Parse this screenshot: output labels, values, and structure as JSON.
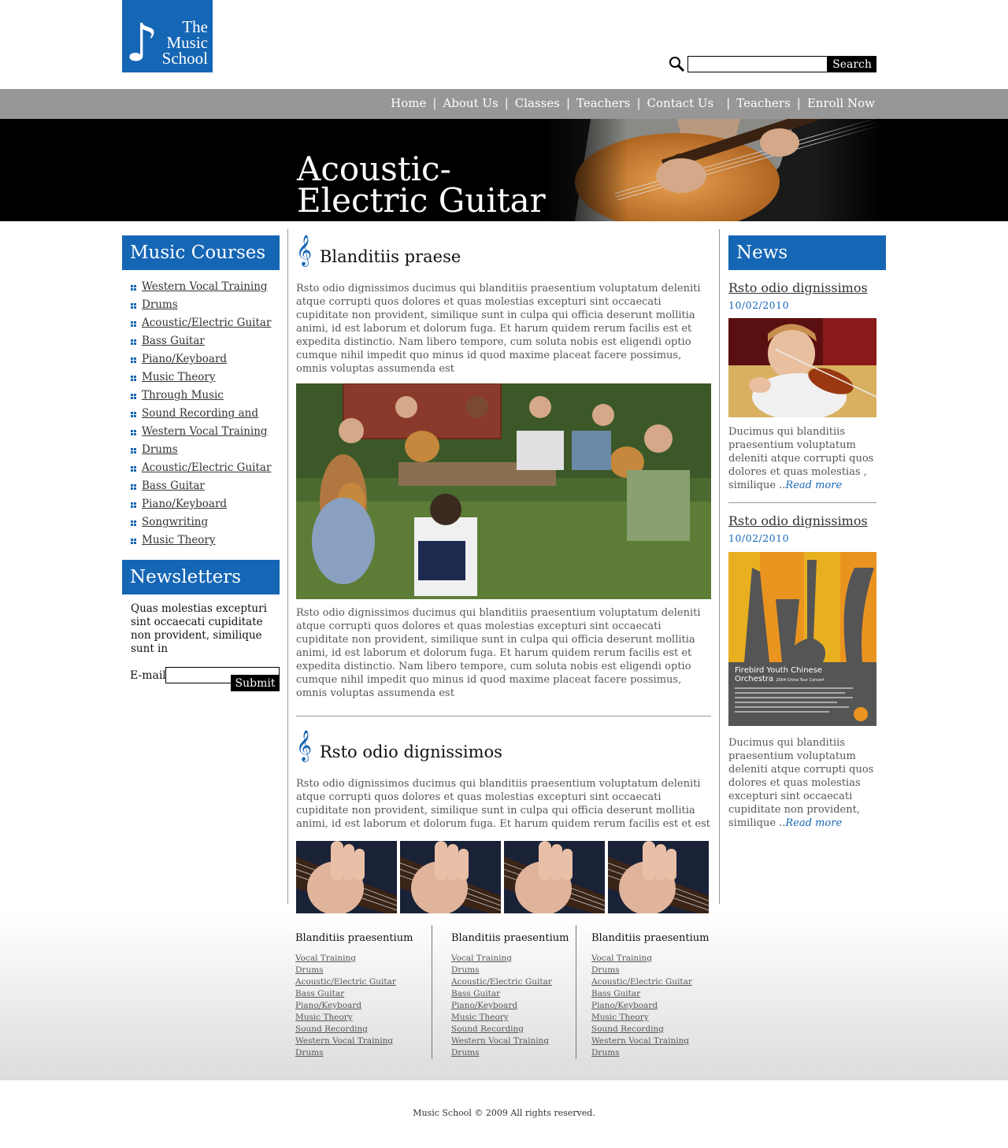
{
  "logo": {
    "line1": "The",
    "line2": "Music",
    "line3": "School"
  },
  "search": {
    "button": "Search",
    "placeholder": ""
  },
  "nav": [
    "Home",
    "About Us",
    "Classes",
    "Teachers",
    "Contact Us",
    "Teachers",
    "Enroll Now"
  ],
  "banner": {
    "line1": "Acoustic-",
    "line2": "Electric Guitar"
  },
  "courses": {
    "title": "Music Courses",
    "items": [
      "Western Vocal Training",
      "Drums",
      "Acoustic/Electric Guitar",
      "Bass Guitar",
      "Piano/Keyboard",
      "Music Theory",
      "Through Music",
      "Sound Recording and ",
      "Western Vocal Training",
      "Drums",
      "Acoustic/Electric Guitar",
      "Bass Guitar",
      "Piano/Keyboard",
      "Songwriting",
      "Music Theory"
    ]
  },
  "newsletters": {
    "title": "Newsletters",
    "text": "Quas molestias excepturi sint occaecati cupiditate non provident, similique sunt in",
    "email_label": "E-mail",
    "email_value": "",
    "submit": "Submit"
  },
  "article1": {
    "title": "Blanditiis praese",
    "para1": "Rsto odio dignissimos ducimus qui blanditiis praesentium voluptatum deleniti atque corrupti quos dolores et quas molestias excepturi sint occaecati cupiditate non provident, similique sunt in culpa qui officia deserunt mollitia animi, id est laborum et dolorum fuga. Et harum quidem rerum facilis est et expedita distinctio. Nam libero tempore, cum soluta nobis est eligendi optio cumque nihil impedit quo minus id quod maxime placeat facere possimus, omnis voluptas assumenda est",
    "para2": "Rsto odio dignissimos ducimus qui blanditiis praesentium voluptatum deleniti atque corrupti quos dolores et quas molestias excepturi sint occaecati cupiditate non provident, similique sunt in culpa qui officia deserunt mollitia animi, id est laborum et dolorum fuga. Et harum quidem rerum facilis est et expedita distinctio. Nam libero tempore, cum soluta nobis est eligendi optio cumque nihil impedit quo minus id quod maxime placeat facere possimus, omnis voluptas assumenda est"
  },
  "article2": {
    "title": "Rsto odio dignissimos",
    "para": "Rsto odio dignissimos ducimus qui blanditiis praesentium voluptatum deleniti atque corrupti quos dolores et quas molestias excepturi sint occaecati cupiditate non provident, similique sunt in culpa qui officia deserunt mollitia animi, id est laborum et dolorum fuga. Et harum quidem rerum facilis est et est"
  },
  "news": {
    "title": "News",
    "items": [
      {
        "title": "Rsto odio dignissimos",
        "date": "10/02/2010",
        "text": "Ducimus qui blanditiis praesentium voluptatum deleniti atque corrupti quos dolores et quas molestias , similique ..",
        "more": "Read more"
      },
      {
        "title": "Rsto odio dignissimos",
        "date": "10/02/2010",
        "text": "Ducimus qui blanditiis praesentium voluptatum deleniti atque corrupti quos dolores et quas molestias excepturi sint occaecati cupiditate non provident, similique ..",
        "more": "Read more"
      }
    ],
    "poster": {
      "line1": "Firebird Youth Chinese",
      "line2": "Orchestra",
      "line3": "2004 China Tour Concert"
    }
  },
  "footer": {
    "columns": [
      {
        "title": "Blanditiis praesentium",
        "links": [
          "Vocal Training",
          "Drums",
          "Acoustic/Electric Guitar",
          "Bass Guitar",
          "Piano/Keyboard",
          "Music Theory",
          "Sound Recording",
          "Western Vocal Training",
          "Drums"
        ]
      },
      {
        "title": "Blanditiis praesentium",
        "links": [
          "Vocal Training",
          "Drums",
          "Acoustic/Electric Guitar",
          "Bass Guitar",
          "Piano/Keyboard",
          "Music Theory",
          "Sound Recording ",
          "Western Vocal Training",
          "Drums"
        ]
      },
      {
        "title": "Blanditiis praesentium",
        "links": [
          "Vocal Training",
          "Drums",
          "Acoustic/Electric Guitar",
          "Bass Guitar",
          "Piano/Keyboard",
          "Music Theory",
          "Sound Recording ",
          "Western Vocal Training",
          "Drums"
        ]
      }
    ],
    "copyright": "Music School © 2009 All rights reserved."
  },
  "colors": {
    "brand_blue": "#1566b5",
    "nav_gray": "#979797",
    "banner_black": "#000000"
  },
  "icons": {
    "search": "magnifier-icon",
    "clef": "treble-clef-icon",
    "bullet": "grid-bullet-icon",
    "logo": "eighth-note-icon"
  }
}
